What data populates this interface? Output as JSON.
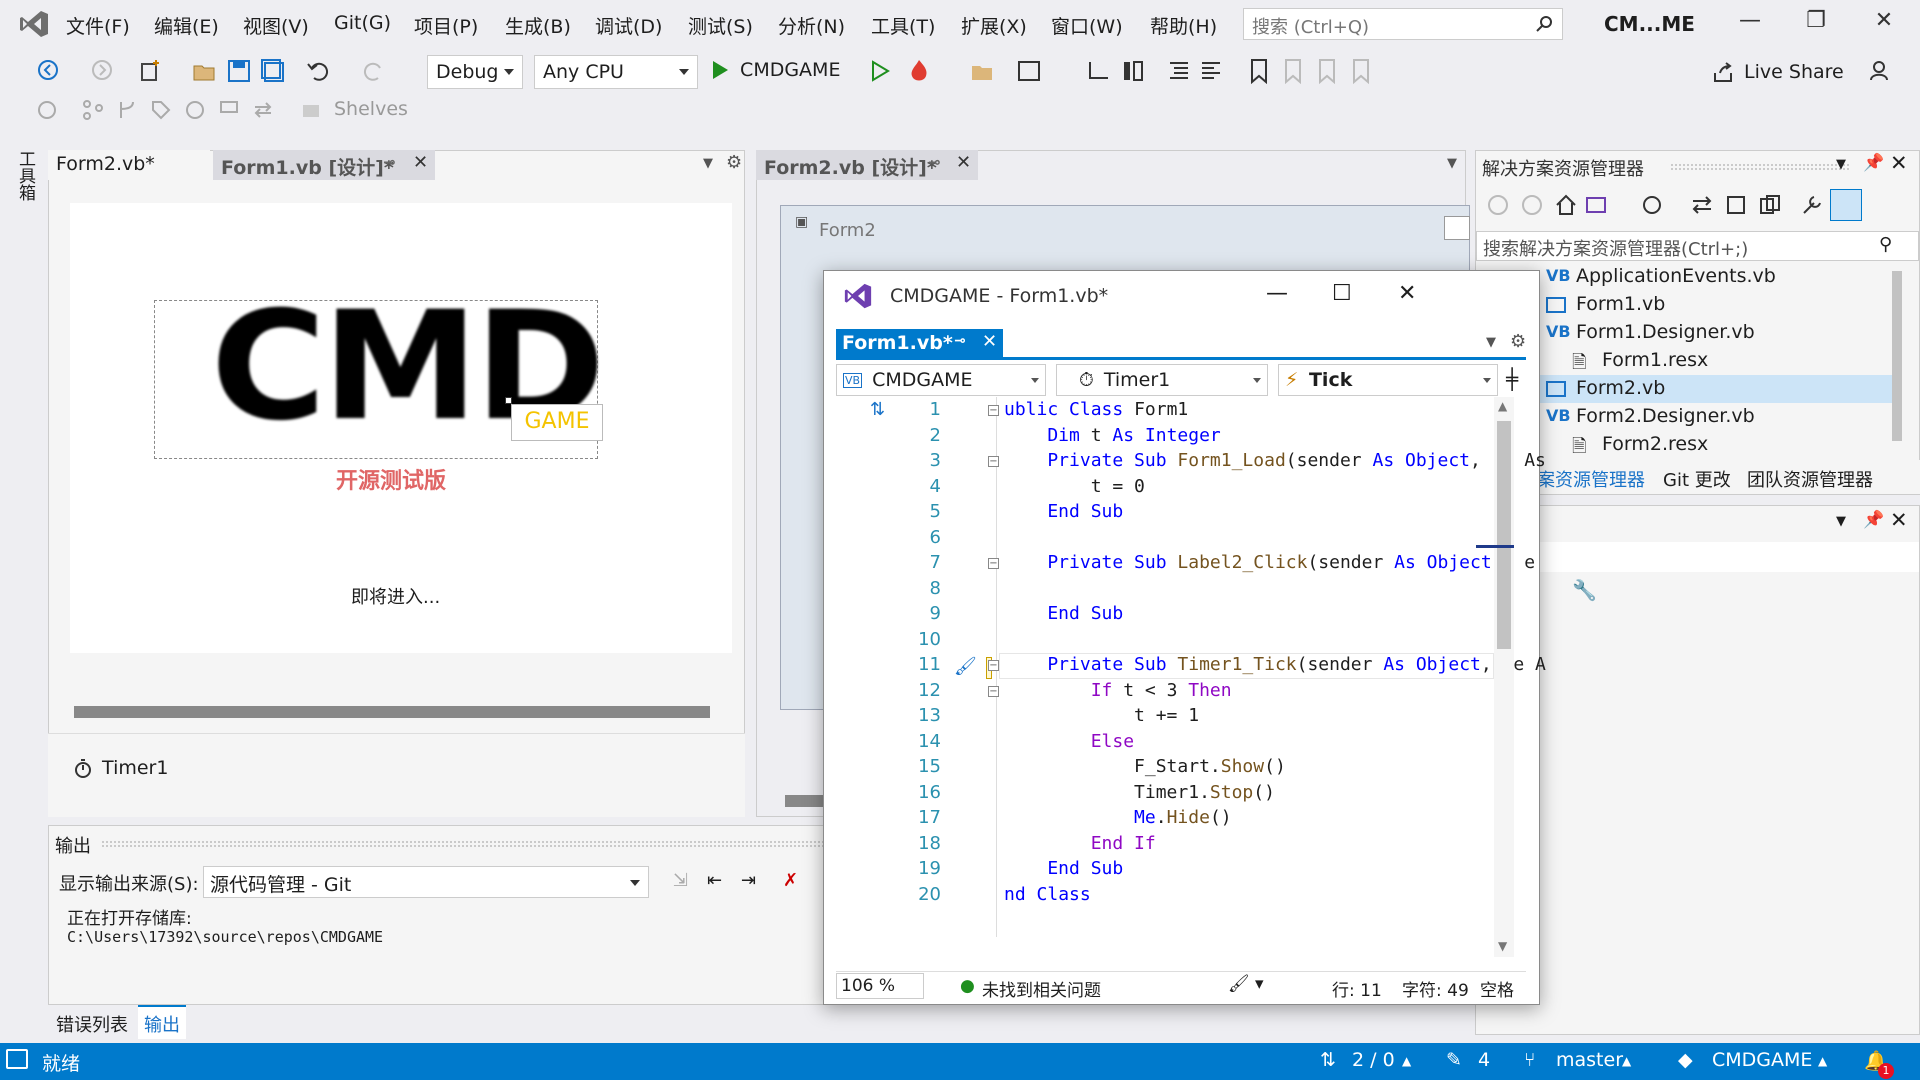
{
  "menubar": {
    "items": [
      "文件(F)",
      "编辑(E)",
      "视图(V)",
      "Git(G)",
      "项目(P)",
      "生成(B)",
      "调试(D)",
      "测试(S)",
      "分析(N)",
      "工具(T)",
      "扩展(X)",
      "窗口(W)",
      "帮助(H)"
    ],
    "search_placeholder": "搜索 (Ctrl+Q)",
    "solution_title": "CM...ME",
    "minimize": "—",
    "maximize": "❐",
    "close": "✕"
  },
  "toolbar": {
    "config": "Debug",
    "platform": "Any CPU",
    "start_label": "CMDGAME",
    "live_share": "Live Share",
    "shelves": "Shelves"
  },
  "toolbox_strip": {
    "label": "工具箱"
  },
  "designer": {
    "tabs": [
      "Form2.vb*",
      "Form1.vb [设计]*"
    ],
    "logo_text": "CMD",
    "game_label": "GAME",
    "subtitle": "开源测试版",
    "entering": "即将进入...",
    "timer": "Timer1"
  },
  "form2_design": {
    "tab": "Form2.vb [设计]*",
    "window_title": "Form2"
  },
  "output": {
    "title": "输出",
    "source_label": "显示输出来源(S):",
    "source_value": "源代码管理 - Git",
    "lines": [
      "正在打开存储库:",
      "C:\\Users\\17392\\source\\repos\\CMDGAME"
    ]
  },
  "bottom_tabs": [
    "错误列表",
    "输出"
  ],
  "code_window": {
    "title": "CMDGAME - Form1.vb*",
    "tab": "Form1.vb*",
    "nav_project": "CMDGAME",
    "nav_object": "Timer1",
    "nav_event": "Tick",
    "lines": [
      {
        "n": "1",
        "parts": [
          [
            "ublic ",
            "kw"
          ],
          [
            "Class ",
            "kw"
          ],
          [
            "Form1",
            ""
          ]
        ]
      },
      {
        "n": "2",
        "parts": [
          [
            "    Dim ",
            "kw"
          ],
          [
            "t ",
            ""
          ],
          [
            "As ",
            "kw"
          ],
          [
            "Integer",
            "kw"
          ]
        ]
      },
      {
        "n": "3",
        "parts": [
          [
            "    Private ",
            "kw"
          ],
          [
            "Sub ",
            "kw"
          ],
          [
            "Form1_Load",
            "fn"
          ],
          [
            "(sender ",
            ""
          ],
          [
            "As ",
            "kw"
          ],
          [
            "Object",
            "kw"
          ],
          [
            ",  e As",
            ""
          ]
        ]
      },
      {
        "n": "4",
        "parts": [
          [
            "        t = 0",
            ""
          ]
        ]
      },
      {
        "n": "5",
        "parts": [
          [
            "    End ",
            "kw"
          ],
          [
            "Sub",
            "kw"
          ]
        ]
      },
      {
        "n": "6",
        "parts": [
          [
            "",
            ""
          ]
        ]
      },
      {
        "n": "7",
        "parts": [
          [
            "    Private ",
            "kw"
          ],
          [
            "Sub ",
            "kw"
          ],
          [
            "Label2_Click",
            "fn"
          ],
          [
            "(sender ",
            ""
          ],
          [
            "As ",
            "kw"
          ],
          [
            "Object",
            "kw"
          ],
          [
            ",  e",
            ""
          ]
        ]
      },
      {
        "n": "8",
        "parts": [
          [
            "",
            ""
          ]
        ]
      },
      {
        "n": "9",
        "parts": [
          [
            "    End ",
            "kw"
          ],
          [
            "Sub",
            "kw"
          ]
        ]
      },
      {
        "n": "10",
        "parts": [
          [
            "",
            ""
          ]
        ]
      },
      {
        "n": "11",
        "parts": [
          [
            "    Private ",
            "kw"
          ],
          [
            "Sub ",
            "kw"
          ],
          [
            "Timer1_Tick",
            "fn"
          ],
          [
            "(sender ",
            ""
          ],
          [
            "As ",
            "kw"
          ],
          [
            "Object",
            "kw"
          ],
          [
            ",  e A",
            ""
          ]
        ]
      },
      {
        "n": "12",
        "parts": [
          [
            "        If ",
            "kw2"
          ],
          [
            "t < 3 ",
            ""
          ],
          [
            "Then",
            "kw2"
          ]
        ]
      },
      {
        "n": "13",
        "parts": [
          [
            "            t += 1",
            ""
          ]
        ]
      },
      {
        "n": "14",
        "parts": [
          [
            "        Else",
            "kw2"
          ]
        ]
      },
      {
        "n": "15",
        "parts": [
          [
            "            F_Start.",
            ""
          ],
          [
            "Show",
            "fn"
          ],
          [
            "()",
            ""
          ]
        ]
      },
      {
        "n": "16",
        "parts": [
          [
            "            Timer1.",
            ""
          ],
          [
            "Stop",
            "fn"
          ],
          [
            "()",
            ""
          ]
        ]
      },
      {
        "n": "17",
        "parts": [
          [
            "            ",
            ""
          ],
          [
            "Me",
            "kw"
          ],
          [
            ".",
            ""
          ],
          [
            "Hide",
            "fn"
          ],
          [
            "()",
            ""
          ]
        ]
      },
      {
        "n": "18",
        "parts": [
          [
            "        End ",
            "kw2"
          ],
          [
            "If",
            "kw2"
          ]
        ]
      },
      {
        "n": "19",
        "parts": [
          [
            "    End ",
            "kw"
          ],
          [
            "Sub",
            "kw"
          ]
        ]
      },
      {
        "n": "20",
        "parts": [
          [
            "nd ",
            "kw"
          ],
          [
            "Class",
            "kw"
          ]
        ]
      }
    ],
    "zoom": "106 %",
    "issues": "未找到相关问题",
    "line_info": "行: 11",
    "char_info": "字符: 49",
    "space": "空格"
  },
  "solution_explorer": {
    "title": "解决方案资源管理器",
    "search_placeholder": "搜索解决方案资源管理器(Ctrl+;)",
    "items": [
      {
        "label": "ApplicationEvents.vb",
        "type": "VB"
      },
      {
        "label": "Form1.vb",
        "type": "form"
      },
      {
        "label": "Form1.Designer.vb",
        "type": "VB"
      },
      {
        "label": "Form1.resx",
        "type": "resx"
      },
      {
        "label": "Form2.vb",
        "type": "form"
      },
      {
        "label": "Form2.Designer.vb",
        "type": "VB"
      },
      {
        "label": "Form2.resx",
        "type": "resx"
      }
    ],
    "tabs": [
      "案资源管理器",
      "Git 更改",
      "团队资源管理器"
    ]
  },
  "statusbar": {
    "ready": "就绪",
    "arrows": "2 / 0",
    "pencil": "4",
    "branch": "master",
    "repo": "CMDGAME",
    "notifications": "1"
  },
  "colors": {
    "accent": "#007acc",
    "keyword": "#0000ff",
    "game_text": "#f4c300",
    "subtitle_red": "#e06666"
  }
}
